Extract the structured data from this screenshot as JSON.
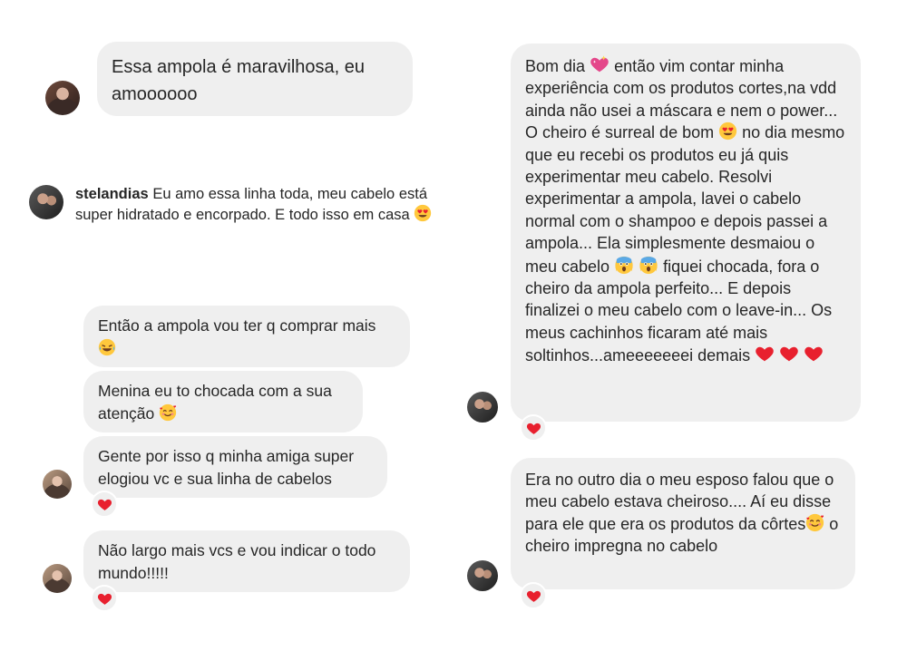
{
  "left_column": {
    "top_message": "Essa ampola é maravilhosa, eu amoooooo",
    "comment": {
      "username": "stelandias",
      "text": "Eu amo essa linha toda, meu cabelo está super hidratado e encorpado. E todo isso em casa"
    },
    "messages": [
      {
        "text": "Então a ampola vou ter q comprar mais"
      },
      {
        "text": "Menina eu to chocada com a sua atenção"
      },
      {
        "text": "Gente por isso q minha amiga super elogiou vc e sua linha de cabelos"
      },
      {
        "text": "Não largo mais vcs e vou indicar o todo mundo!!!!!"
      }
    ]
  },
  "right_column": {
    "long_message": {
      "part1": "Bom dia",
      "part2": "então vim contar minha experiência com os produtos cortes,na vdd ainda não usei a máscara e nem o power... O cheiro é surreal de bom",
      "part3": "no dia mesmo que eu recebi os produtos eu já quis experimentar meu cabelo. Resolvi experimentar a ampola, lavei o cabelo normal com o shampoo e depois passei a ampola... Ela simplesmente desmaiou o meu cabelo",
      "part4": "fiquei chocada, fora o cheiro da ampola perfeito... E depois finalizei o meu cabelo com o leave-in... Os meus cachinhos ficaram até mais soltinhos...ameeeeeeei demais"
    },
    "second_message": {
      "part1": "Era no outro dia o meu esposo falou que o meu cabelo estava cheiroso.... Aí eu disse para ele que era os produtos da côrtes",
      "part2": "o cheiro impregna no cabelo"
    }
  },
  "icons": {
    "heart_reaction": "red-heart-icon",
    "heart_eyes": "heart-eyes-emoji",
    "laughing": "tears-of-joy-emoji",
    "smiling_hearts": "smiling-face-with-hearts-emoji",
    "scream": "screaming-face-emoji",
    "sparkling_heart": "sparkling-heart-emoji"
  },
  "colors": {
    "bubble": "#efefef",
    "heart": "#e0245e"
  }
}
